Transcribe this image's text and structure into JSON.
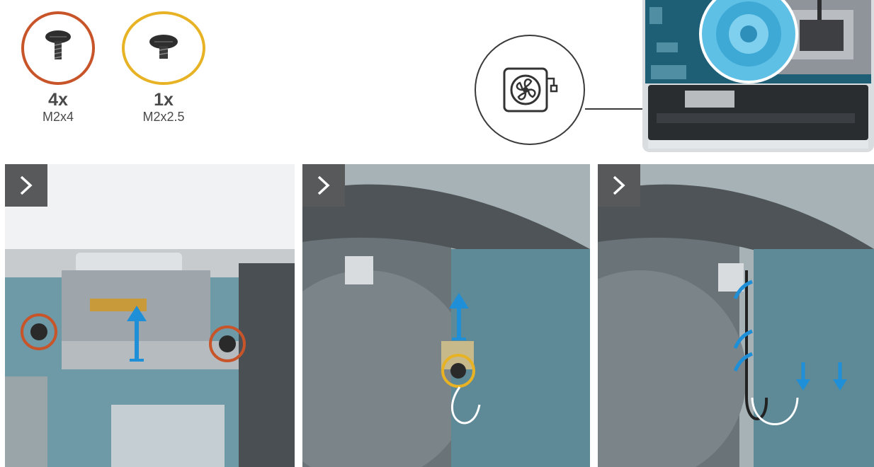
{
  "screws": [
    {
      "quantity": "4x",
      "size": "M2x4",
      "ring_color": "#c8542a"
    },
    {
      "quantity": "1x",
      "size": "M2x2.5",
      "ring_color": "#e7b325"
    }
  ],
  "icons": {
    "component": "fan-icon",
    "step": "chevron-right-icon",
    "lift": "arrow-up-icon",
    "route": "curved-arrow-icon",
    "disconnect": "arrow-down-icon"
  },
  "panels": [
    {
      "step_icon": "chevron-right-icon"
    },
    {
      "step_icon": "chevron-right-icon"
    },
    {
      "step_icon": "chevron-right-icon"
    }
  ],
  "colors": {
    "accent": "#1f8fd8",
    "board": "#2b6f86",
    "step_button": "#58595b"
  }
}
